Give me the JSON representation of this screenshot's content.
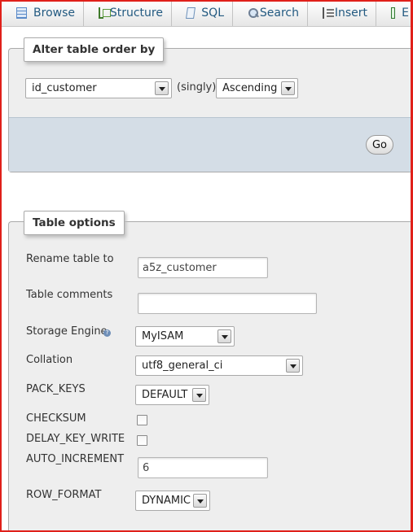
{
  "tabs": [
    {
      "label": "Browse",
      "icon": "browse-icon"
    },
    {
      "label": "Structure",
      "icon": "structure-icon"
    },
    {
      "label": "SQL",
      "icon": "sql-icon"
    },
    {
      "label": "Search",
      "icon": "search-icon"
    },
    {
      "label": "Insert",
      "icon": "insert-icon"
    },
    {
      "label": "E",
      "icon": "export-icon"
    }
  ],
  "alter_order": {
    "legend": "Alter table order by",
    "column_value": "id_customer",
    "singly_text": "(singly)",
    "direction_value": "Ascending",
    "go_label": "Go"
  },
  "table_options": {
    "legend": "Table options",
    "rename_label": "Rename table to",
    "rename_value": "a5z_customer",
    "comments_label": "Table comments",
    "comments_value": "",
    "engine_label": "Storage Engine",
    "engine_value": "MyISAM",
    "collation_label": "Collation",
    "collation_value": "utf8_general_ci",
    "pack_keys_label": "PACK_KEYS",
    "pack_keys_value": "DEFAULT",
    "checksum_label": "CHECKSUM",
    "checksum_checked": false,
    "delay_key_write_label": "DELAY_KEY_WRITE",
    "delay_key_write_checked": false,
    "auto_increment_label": "AUTO_INCREMENT",
    "auto_increment_value": "6",
    "row_format_label": "ROW_FORMAT",
    "row_format_value": "DYNAMIC"
  },
  "colors": {
    "frame": "#e0201a",
    "tab_text": "#235a81",
    "panel": "#eeeeee",
    "go_bar": "#d4dde6"
  }
}
